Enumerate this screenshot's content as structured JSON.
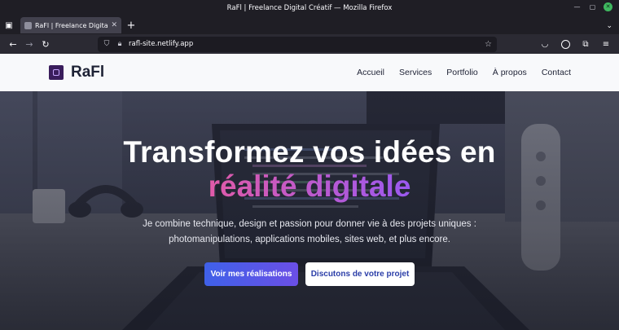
{
  "browser": {
    "window_title": "RaFl | Freelance Digital Créatif — Mozilla Firefox",
    "tab_title": "RaFl | Freelance Digital Créatif",
    "url": "rafl-site.netlify.app"
  },
  "site": {
    "brand": "RaFl",
    "nav": [
      {
        "label": "Accueil"
      },
      {
        "label": "Services"
      },
      {
        "label": "Portfolio"
      },
      {
        "label": "À propos"
      },
      {
        "label": "Contact"
      }
    ],
    "hero": {
      "title_line1": "Transformez vos idées en",
      "title_line2": "réalité digitale",
      "lead": "Je combine technique, design et passion pour donner vie à des projets uniques : photomanipulations, applications mobiles, sites web, et plus encore.",
      "cta_primary": "Voir mes réalisations",
      "cta_secondary": "Discutons de votre projet"
    }
  },
  "colors": {
    "gradient_start": "#e05aa8",
    "gradient_end": "#9b59f0",
    "primary_button": "#4f5ae8"
  }
}
